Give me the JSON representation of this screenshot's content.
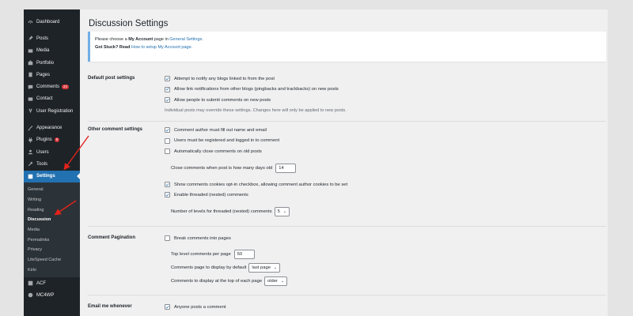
{
  "sidebar": {
    "items_top": [
      {
        "label": "Dashboard",
        "icon": "dashboard-icon"
      }
    ],
    "items_content": [
      {
        "label": "Posts",
        "icon": "pin-icon"
      },
      {
        "label": "Media",
        "icon": "media-icon"
      },
      {
        "label": "Portfolio",
        "icon": "portfolio-icon"
      },
      {
        "label": "Pages",
        "icon": "pages-icon"
      },
      {
        "label": "Comments",
        "icon": "comments-icon",
        "badge": "22"
      },
      {
        "label": "Contact",
        "icon": "mail-icon"
      },
      {
        "label": "User Registration",
        "icon": "user-registration-icon"
      }
    ],
    "items_admin": [
      {
        "label": "Appearance",
        "icon": "brush-icon"
      },
      {
        "label": "Plugins",
        "icon": "plugin-icon",
        "badge": "8"
      },
      {
        "label": "Users",
        "icon": "users-icon"
      },
      {
        "label": "Tools",
        "icon": "wrench-icon"
      },
      {
        "label": "Settings",
        "icon": "settings-icon",
        "active": true
      }
    ],
    "submenu": [
      "General",
      "Writing",
      "Reading",
      "Discussion",
      "Media",
      "Permalinks",
      "Privacy",
      "LiteSpeed Cache",
      "Kirki"
    ],
    "submenu_current": "Discussion",
    "items_bottom": [
      {
        "label": "ACF",
        "icon": "acf-icon"
      },
      {
        "label": "MC4WP",
        "icon": "mc4wp-icon"
      }
    ]
  },
  "page": {
    "title": "Discussion Settings"
  },
  "notice": {
    "line1_prefix": "Please choose a",
    "line1_bold": "My Account",
    "line1_mid": "page in",
    "line1_link": "General Settings",
    "line1_end": ".",
    "line2_bold": "Got Stuck? Read",
    "line2_link": "How to setup My Account page."
  },
  "sections": {
    "default_post": {
      "label": "Default post settings",
      "options": [
        {
          "label": "Attempt to notify any blogs linked to from the post",
          "checked": true
        },
        {
          "label": "Allow link notifications from other blogs (pingbacks and trackbacks) on new posts",
          "checked": true
        },
        {
          "label": "Allow people to submit comments on new posts",
          "checked": true
        }
      ],
      "description": "Individual posts may override these settings. Changes here will only be applied to new posts."
    },
    "other_comment": {
      "label": "Other comment settings",
      "options": [
        {
          "label": "Comment author must fill out name and email",
          "checked": true
        },
        {
          "label": "Users must be registered and logged in to comment",
          "checked": false
        },
        {
          "label": "Automatically close comments on old posts",
          "checked": false
        }
      ],
      "close_days_label": "Close comments when post is how many days old",
      "close_days_value": "14",
      "cookies_label": "Show comments cookies opt-in checkbox, allowing comment author cookies to be set",
      "cookies_checked": true,
      "threaded_label": "Enable threaded (nested) comments",
      "threaded_checked": true,
      "levels_label": "Number of levels for threaded (nested) comments",
      "levels_value": "5"
    },
    "pagination": {
      "label": "Comment Pagination",
      "break_label": "Break comments into pages",
      "break_checked": false,
      "top_level_label": "Top level comments per page",
      "top_level_value": "50",
      "default_page_label": "Comments page to display by default",
      "default_page_value": "last page",
      "order_label": "Comments to display at the top of each page",
      "order_value": "older"
    },
    "email": {
      "label": "Email me whenever",
      "anyone_label": "Anyone posts a comment",
      "anyone_checked": true
    }
  },
  "colors": {
    "sidebar_bg": "#1d2327",
    "active_blue": "#2271b1",
    "annotation_red": "#e2231a",
    "badge_red": "#d63638"
  }
}
